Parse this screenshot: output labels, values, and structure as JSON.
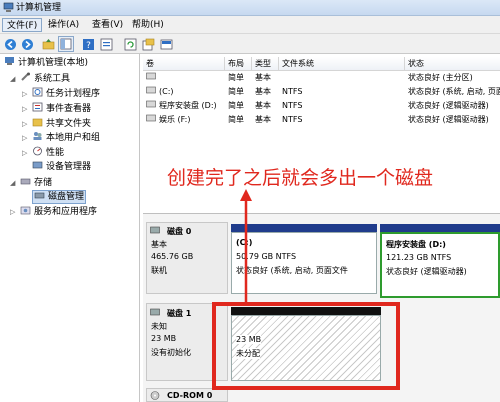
{
  "window": {
    "title": "计算机管理"
  },
  "menu": [
    "文件(F)",
    "操作(A)",
    "查看(V)",
    "帮助(H)"
  ],
  "toolbar_icons": [
    "back-icon",
    "forward-icon",
    "up-folder-icon",
    "console-tree-icon",
    "help-icon",
    "properties-icon",
    "refresh-icon",
    "export-icon",
    "view-icon"
  ],
  "tree": {
    "root": "计算机管理(本地)",
    "system_tools": "系统工具",
    "task_scheduler": "任务计划程序",
    "event_viewer": "事件查看器",
    "shared_folders": "共享文件夹",
    "local_users": "本地用户和组",
    "performance": "性能",
    "device_manager": "设备管理器",
    "storage": "存储",
    "disk_management": "磁盘管理",
    "services": "服务和应用程序"
  },
  "volumes": {
    "headers": [
      "卷",
      "布局",
      "类型",
      "文件系统",
      "状态"
    ],
    "rows": [
      [
        "",
        "简单",
        "基本",
        "",
        "状态良好 (主分区)"
      ],
      [
        "(C:)",
        "简单",
        "基本",
        "NTFS",
        "状态良好 (系统, 启动, 页面文件, 活动, 故障转储, 主分区)"
      ],
      [
        "程序安装盘 (D:)",
        "简单",
        "基本",
        "NTFS",
        "状态良好 (逻辑驱动器)"
      ],
      [
        "娱乐 (F:)",
        "简单",
        "基本",
        "NTFS",
        "状态良好 (逻辑驱动器)"
      ]
    ]
  },
  "disks": {
    "disk0": {
      "name": "磁盘 0",
      "type": "基本",
      "size": "465.76 GB",
      "status": "联机"
    },
    "disk0_c": {
      "label": "(C:)",
      "size": "50.79 GB NTFS",
      "status": "状态良好 (系统, 启动, 页面文件"
    },
    "disk0_d": {
      "label": "程序安装盘 (D:)",
      "size": "121.23 GB NTFS",
      "status": "状态良好 (逻辑驱动器)"
    },
    "disk1": {
      "name": "磁盘 1",
      "type": "未知",
      "size": "23 MB",
      "status": "没有初始化"
    },
    "disk1_part": {
      "size": "23 MB",
      "status": "未分配"
    },
    "cdrom": {
      "name": "CD-ROM 0"
    }
  },
  "annotation": "创建完了之后就会多出一个磁盘",
  "colors": {
    "annotation": "#e0281e",
    "primary_partition_bar": "#203c8c",
    "unallocated_bar": "#111111",
    "selected_partition_border": "#2e9b2e"
  }
}
